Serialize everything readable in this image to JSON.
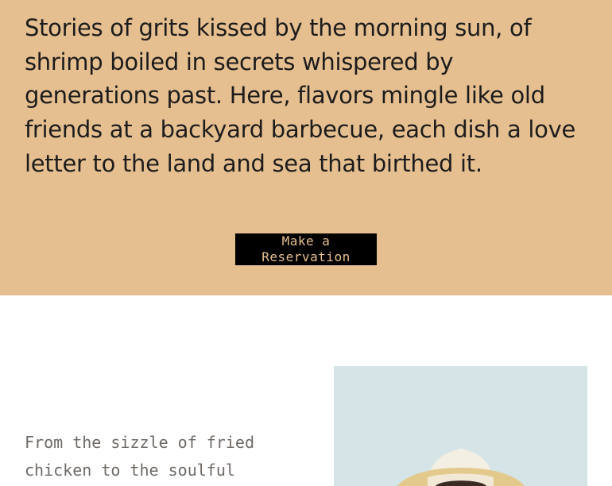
{
  "hero": {
    "story_text": "Stories of grits kissed by the morning sun, of shrimp boiled in secrets whispered by generations past. Here, flavors mingle like old friends at a backyard barbecue, each dish a love letter to the land and sea that birthed it.",
    "reservation_button_line1": "Make a",
    "reservation_button_line2": "Reservation"
  },
  "intro": {
    "text": "From the sizzle of fried chicken to the soulful"
  },
  "colors": {
    "hero_background": "#e6bf90",
    "button_background": "#000000",
    "button_text": "#e6bf90",
    "body_text": "#6f6a66",
    "photo_background": "#d5e4e7"
  },
  "icons": {
    "photo": "person-in-straw-hat-photo"
  }
}
